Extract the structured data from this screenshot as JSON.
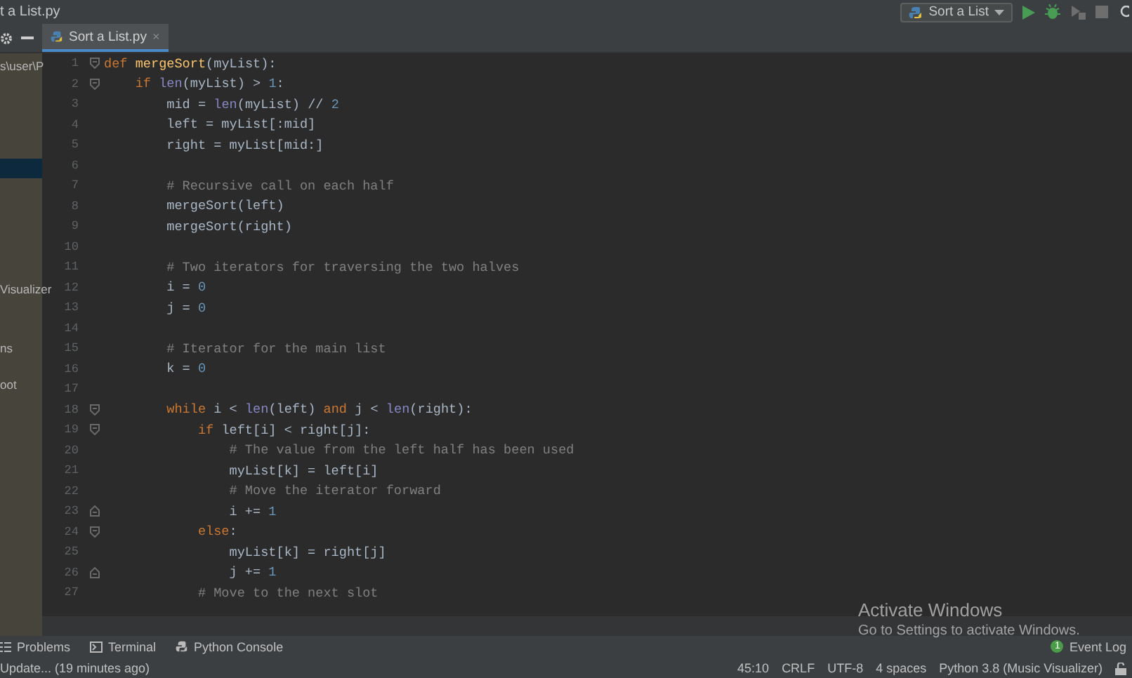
{
  "window": {
    "title": "t a List.py"
  },
  "toolbar": {
    "run_config": "Sort a List"
  },
  "tabs": [
    {
      "label": "Sort a List.py",
      "close": "×",
      "selected": true
    }
  ],
  "project_panel": {
    "items": [
      {
        "label": "s\\user\\P",
        "selected": false
      },
      {
        "selected": true
      },
      {
        "label": "Visualizer",
        "selected": false
      },
      {
        "label": "ns",
        "selected": false
      },
      {
        "label": "oot",
        "selected": false
      }
    ]
  },
  "editor": {
    "lines": [
      {
        "number": "1",
        "fold": {
          "kind": "open"
        },
        "tokens": [
          {
            "kind": "keyword",
            "text": "def "
          },
          {
            "kind": "function",
            "text": "mergeSort"
          },
          {
            "kind": "plain",
            "text": "(myList):"
          }
        ]
      },
      {
        "number": "2",
        "fold": {
          "kind": "open"
        },
        "tokens": [
          {
            "kind": "keyword",
            "text": "    if "
          },
          {
            "kind": "builtin",
            "text": "len"
          },
          {
            "kind": "plain",
            "text": "(myList) > "
          },
          {
            "kind": "number",
            "text": "1"
          },
          {
            "kind": "plain",
            "text": ":"
          }
        ]
      },
      {
        "number": "3",
        "tokens": [
          {
            "kind": "plain",
            "text": "        mid = "
          },
          {
            "kind": "builtin",
            "text": "len"
          },
          {
            "kind": "plain",
            "text": "(myList) // "
          },
          {
            "kind": "number",
            "text": "2"
          }
        ]
      },
      {
        "number": "4",
        "tokens": [
          {
            "kind": "plain",
            "text": "        left = myList[:mid]"
          }
        ]
      },
      {
        "number": "5",
        "tokens": [
          {
            "kind": "plain",
            "text": "        right = myList[mid:]"
          }
        ]
      },
      {
        "number": "6"
      },
      {
        "number": "7",
        "tokens": [
          {
            "kind": "comment",
            "text": "        # Recursive call on each half"
          }
        ]
      },
      {
        "number": "8",
        "tokens": [
          {
            "kind": "plain",
            "text": "        mergeSort(left)"
          }
        ]
      },
      {
        "number": "9",
        "tokens": [
          {
            "kind": "plain",
            "text": "        mergeSort(right)"
          }
        ]
      },
      {
        "number": "10"
      },
      {
        "number": "11",
        "tokens": [
          {
            "kind": "comment",
            "text": "        # Two iterators for traversing the two halves"
          }
        ]
      },
      {
        "number": "12",
        "tokens": [
          {
            "kind": "plain",
            "text": "        i = "
          },
          {
            "kind": "number",
            "text": "0"
          }
        ]
      },
      {
        "number": "13",
        "tokens": [
          {
            "kind": "plain",
            "text": "        j = "
          },
          {
            "kind": "number",
            "text": "0"
          }
        ]
      },
      {
        "number": "14"
      },
      {
        "number": "15",
        "tokens": [
          {
            "kind": "comment",
            "text": "        # Iterator for the main list"
          }
        ]
      },
      {
        "number": "16",
        "tokens": [
          {
            "kind": "plain",
            "text": "        k = "
          },
          {
            "kind": "number",
            "text": "0"
          }
        ]
      },
      {
        "number": "17"
      },
      {
        "number": "18",
        "fold": {
          "kind": "open"
        },
        "tokens": [
          {
            "kind": "keyword",
            "text": "        while "
          },
          {
            "kind": "plain",
            "text": "i < "
          },
          {
            "kind": "builtin",
            "text": "len"
          },
          {
            "kind": "plain",
            "text": "(left) "
          },
          {
            "kind": "keyword",
            "text": "and "
          },
          {
            "kind": "plain",
            "text": "j < "
          },
          {
            "kind": "builtin",
            "text": "len"
          },
          {
            "kind": "plain",
            "text": "(right):"
          }
        ]
      },
      {
        "number": "19",
        "fold": {
          "kind": "open"
        },
        "tokens": [
          {
            "kind": "keyword",
            "text": "            if "
          },
          {
            "kind": "plain",
            "text": "left[i] < right[j]:"
          }
        ]
      },
      {
        "number": "20",
        "tokens": [
          {
            "kind": "comment",
            "text": "                # The value from the left half has been used"
          }
        ]
      },
      {
        "number": "21",
        "tokens": [
          {
            "kind": "plain",
            "text": "                myList[k] = left[i]"
          }
        ]
      },
      {
        "number": "22",
        "tokens": [
          {
            "kind": "comment",
            "text": "                # Move the iterator forward"
          }
        ]
      },
      {
        "number": "23",
        "fold": {
          "kind": "close"
        },
        "tokens": [
          {
            "kind": "plain",
            "text": "                i += "
          },
          {
            "kind": "number",
            "text": "1"
          }
        ]
      },
      {
        "number": "24",
        "fold": {
          "kind": "open"
        },
        "tokens": [
          {
            "kind": "keyword",
            "text": "            else"
          },
          {
            "kind": "plain",
            "text": ":"
          }
        ]
      },
      {
        "number": "25",
        "tokens": [
          {
            "kind": "plain",
            "text": "                myList[k] = right[j]"
          }
        ]
      },
      {
        "number": "26",
        "fold": {
          "kind": "close"
        },
        "tokens": [
          {
            "kind": "plain",
            "text": "                j += "
          },
          {
            "kind": "number",
            "text": "1"
          }
        ]
      },
      {
        "number": "27",
        "tokens": [
          {
            "kind": "comment",
            "text": "            # Move to the next slot"
          }
        ]
      }
    ]
  },
  "tool_windows": [
    {
      "kind": "problems",
      "label": "Problems"
    },
    {
      "kind": "terminal",
      "label": "Terminal"
    },
    {
      "kind": "console",
      "label": "Python Console"
    }
  ],
  "event_log": {
    "label": "Event Log",
    "count": "1"
  },
  "status_bar": {
    "message": "Update... (19 minutes ago)",
    "items": [
      "45:10",
      "CRLF",
      "UTF-8",
      "4 spaces",
      "Python 3.8 (Music Visualizer)"
    ]
  },
  "activation_notice": {
    "title": "Activate Windows",
    "text": "Go to Settings to activate Windows."
  }
}
